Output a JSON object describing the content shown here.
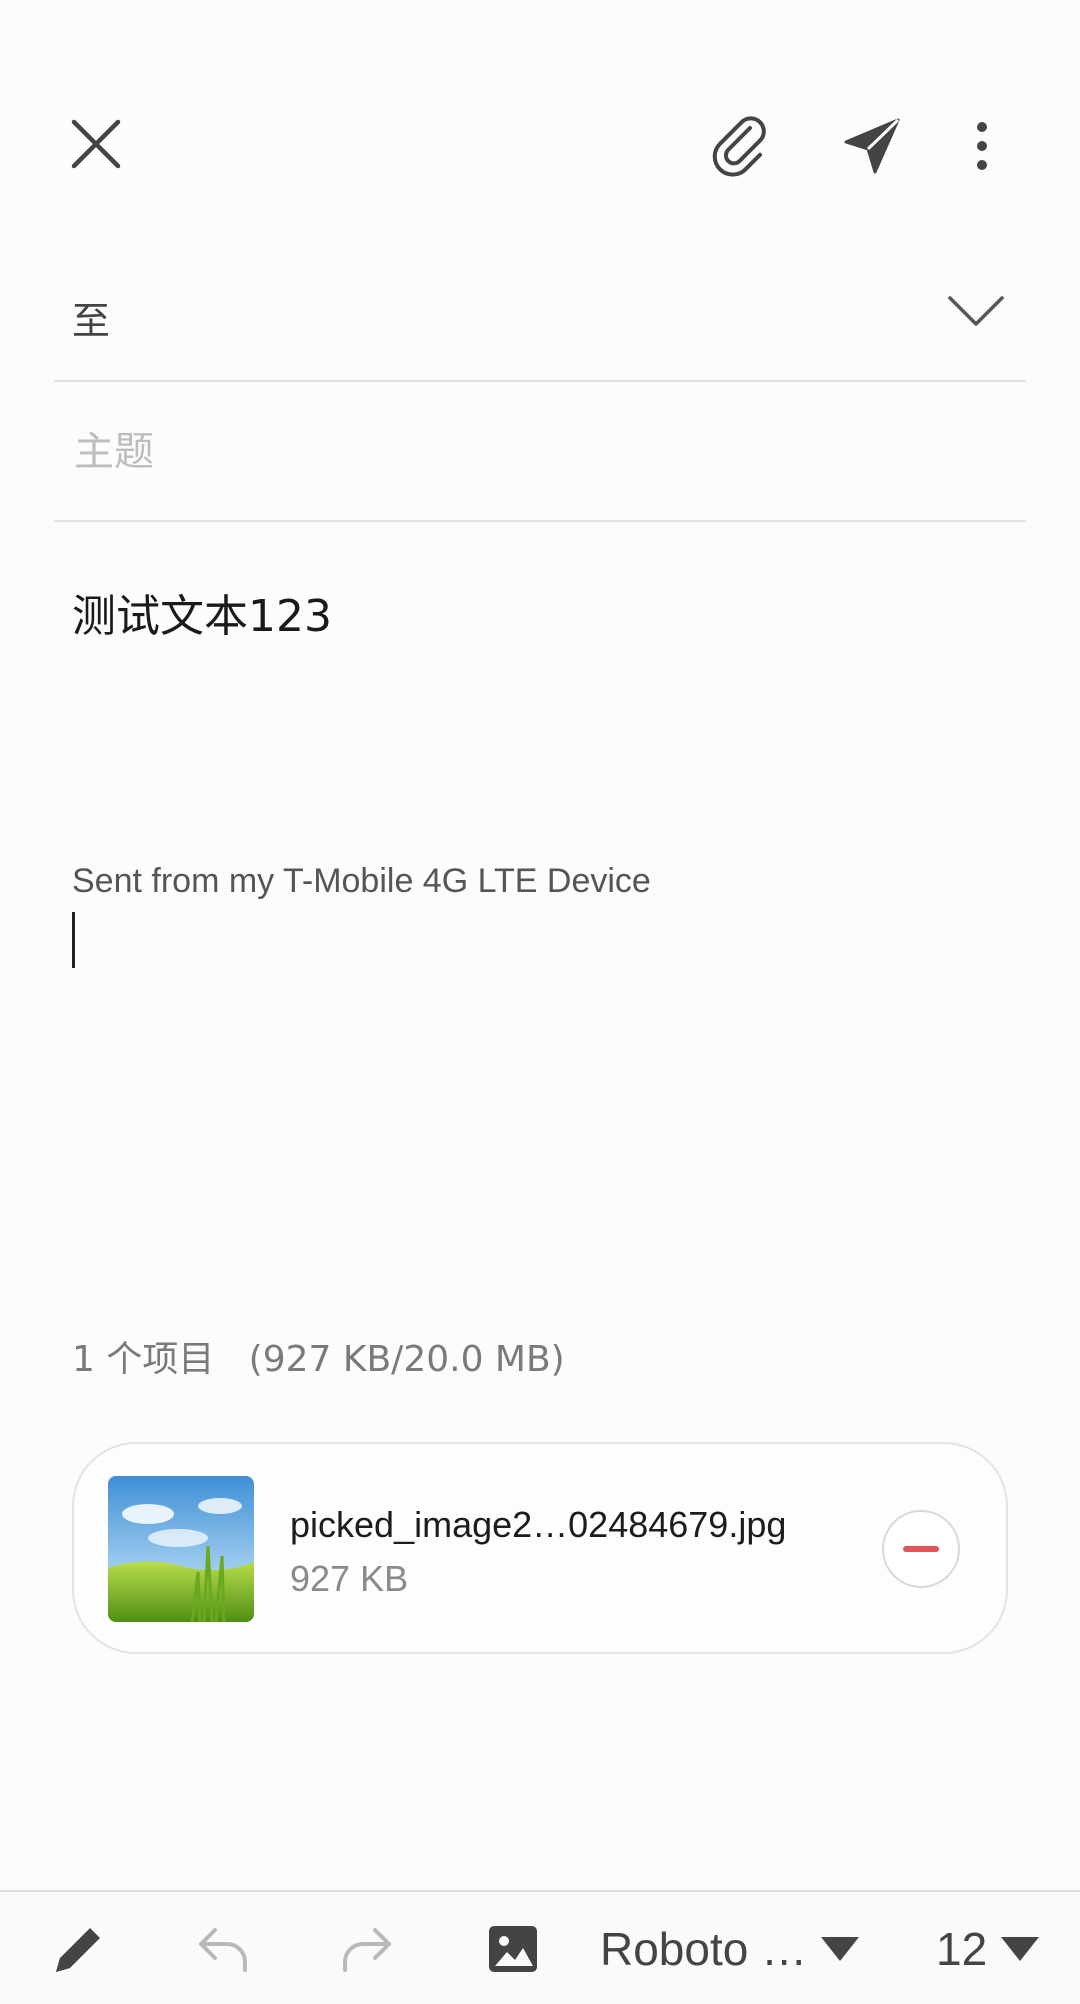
{
  "header": {
    "close_icon": "close-icon",
    "attach_icon": "paperclip-icon",
    "send_icon": "send-icon",
    "more_icon": "more-vert-icon"
  },
  "recipients": {
    "label": "至",
    "expand_icon": "chevron-down-icon"
  },
  "subject": {
    "placeholder": "主题",
    "value": ""
  },
  "body": {
    "text": "测试文本123",
    "signature": "Sent from my T-Mobile 4G LTE Device"
  },
  "attachments": {
    "summary": "1 个项目   (927 KB/20.0 MB)",
    "items": [
      {
        "file_name": "picked_image2…02484679.jpg",
        "file_size": "927 KB",
        "thumbnail": "landscape-thumbnail"
      }
    ],
    "remove_icon": "remove-icon"
  },
  "toolbar": {
    "font_label": "Roboto …",
    "size_label": "12",
    "icons": [
      "pen-icon",
      "undo-icon",
      "redo-icon",
      "image-icon",
      "dropdown-arrow-icon"
    ]
  },
  "colors": {
    "accent_remove": "#e0555a",
    "icon": "#444444",
    "icon_disabled": "#b9b9b9",
    "divider": "#e2e2e2",
    "placeholder": "#bdbdbd"
  }
}
